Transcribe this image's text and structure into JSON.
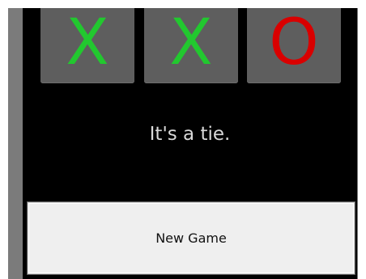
{
  "board": {
    "cells": [
      {
        "mark": "X",
        "color": "#22c82f"
      },
      {
        "mark": "X",
        "color": "#22c82f"
      },
      {
        "mark": "O",
        "color": "#d90000"
      }
    ]
  },
  "status": {
    "message": "It's a tie."
  },
  "actions": {
    "new_game_label": "New Game"
  },
  "colors": {
    "screen_background": "#000000",
    "cell_background": "#5e5e5e",
    "bezel": "#7b7b7b",
    "button_background": "#efefef"
  }
}
